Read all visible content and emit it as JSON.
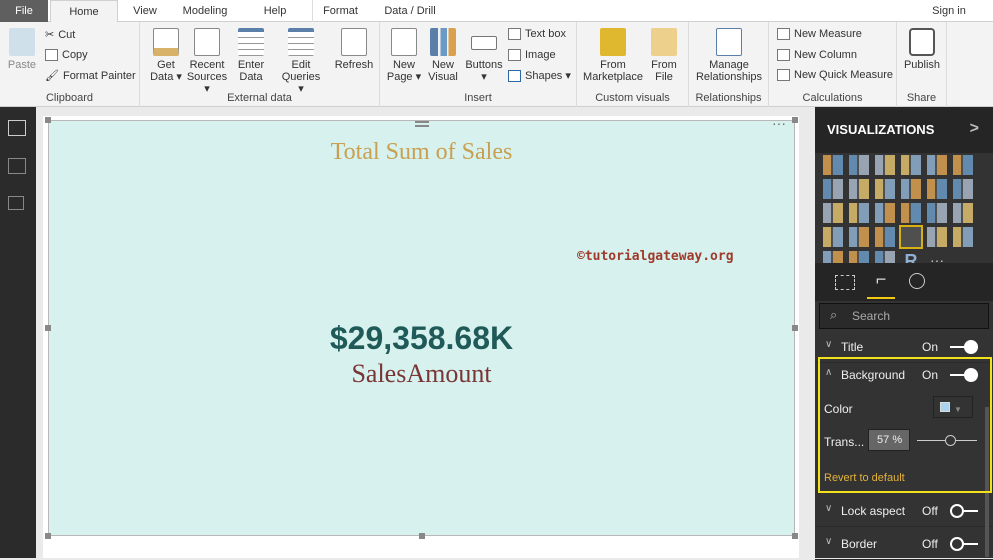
{
  "tabs": [
    "File",
    "Home",
    "View",
    "Modeling",
    "Help",
    "Format",
    "Data / Drill"
  ],
  "sign_in": "Sign in",
  "ribbon": {
    "clipboard": {
      "label": "Clipboard",
      "paste": "Paste",
      "cut": "Cut",
      "copy": "Copy",
      "format_painter": "Format Painter"
    },
    "external": {
      "label": "External data",
      "get_data": "Get Data ▾",
      "recent": "Recent Sources ▾",
      "enter": "Enter Data",
      "edit": "Edit Queries ▾",
      "refresh": "Refresh"
    },
    "insert": {
      "label": "Insert",
      "new_page": "New Page ▾",
      "new_visual": "New Visual",
      "buttons": "Buttons ▾",
      "text_box": "Text box",
      "image": "Image",
      "shapes": "Shapes ▾"
    },
    "custom": {
      "label": "Custom visuals",
      "marketplace": "From Marketplace",
      "file": "From File"
    },
    "relationships": {
      "label": "Relationships",
      "manage": "Manage Relationships"
    },
    "calculations": {
      "label": "Calculations",
      "new_measure": "New Measure",
      "new_column": "New Column",
      "new_quick": "New Quick Measure"
    },
    "share": {
      "label": "Share",
      "publish": "Publish"
    }
  },
  "card": {
    "title": "Total Sum of Sales",
    "watermark": "©tutorialgateway.org",
    "value": "$29,358.68K",
    "label": "SalesAmount",
    "background": "#d6f1ee"
  },
  "pane": {
    "title": "VISUALIZATIONS",
    "search_placeholder": "Search",
    "title_row": {
      "label": "Title",
      "state": "On"
    },
    "background_row": {
      "label": "Background",
      "state": "On"
    },
    "color_label": "Color",
    "color_value": "#a8d4ee",
    "transparency_label": "Trans...",
    "transparency_value": "57",
    "transparency_unit": "%",
    "transparency_pct": 57,
    "revert": "Revert to default",
    "lock_row": {
      "label": "Lock aspect",
      "state": "Off"
    },
    "border_row": {
      "label": "Border",
      "state": "Off"
    },
    "r_visual": "R",
    "more": "···"
  }
}
